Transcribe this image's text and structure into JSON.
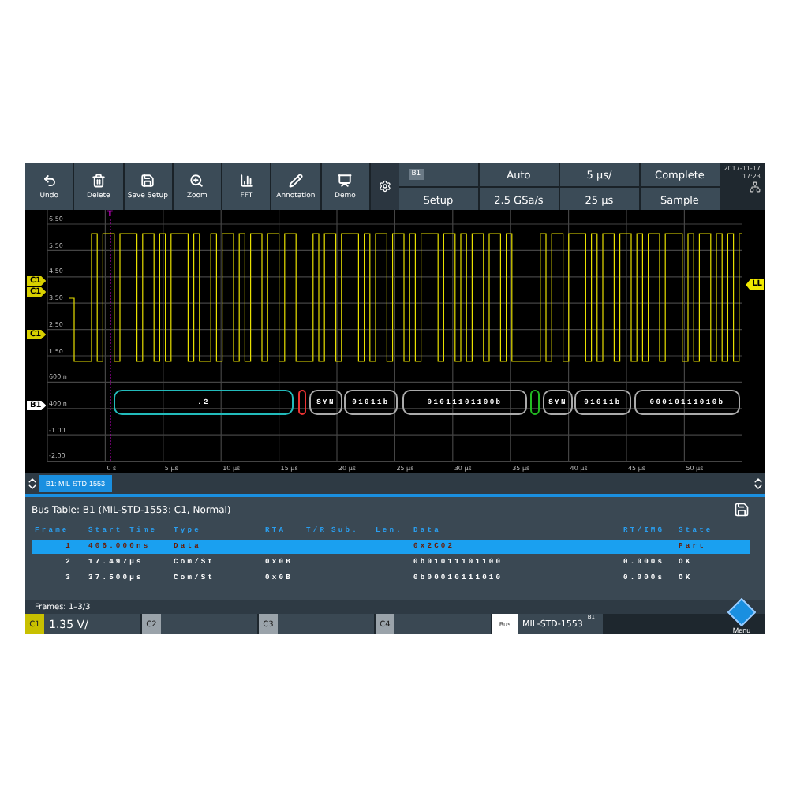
{
  "toolbar": {
    "buttons": [
      {
        "kind": "undo",
        "label": "Undo"
      },
      {
        "kind": "delete",
        "label": "Delete"
      },
      {
        "kind": "save",
        "label": "Save Setup"
      },
      {
        "kind": "zoom",
        "label": "Zoom"
      },
      {
        "kind": "fft",
        "label": "FFT"
      },
      {
        "kind": "annotation",
        "label": "Annotation"
      },
      {
        "kind": "demo",
        "label": "Demo"
      }
    ]
  },
  "acquisition": {
    "source": "B1",
    "setup": "Setup",
    "trigger_mode": "Auto",
    "sample_rate": "2.5 GSa/s",
    "time_scale": "5 µs/",
    "record_length": "25 µs",
    "status": "Complete",
    "mode": "Sample",
    "date": "2017-11-17",
    "time": "17:23"
  },
  "plot": {
    "y_labels": [
      "6.50",
      "5.50",
      "4.50",
      "3.50",
      "2.50",
      "1.50",
      "600 n",
      "400 n",
      "-1.00",
      "-2.00"
    ],
    "x_labels": [
      "0 s",
      "5 µs",
      "10 µs",
      "15 µs",
      "20 µs",
      "25 µs",
      "30 µs",
      "35 µs",
      "40 µs",
      "45 µs",
      "50 µs"
    ],
    "left_markers": [
      {
        "label": "C1"
      },
      {
        "label": "C1"
      },
      {
        "label": "C1"
      }
    ],
    "bus_marker": "B1",
    "right_marker": "LL",
    "trigger_label": "T",
    "bus_segments": [
      {
        "kind": "start",
        "text": ".2"
      },
      {
        "kind": "error"
      },
      {
        "kind": "data",
        "text": "SYN"
      },
      {
        "kind": "data",
        "text": "01011b"
      },
      {
        "kind": "data",
        "text": "01011101100b"
      },
      {
        "kind": "ok"
      },
      {
        "kind": "data",
        "text": "SYN"
      },
      {
        "kind": "data",
        "text": "01011b"
      },
      {
        "kind": "data",
        "text": "00010111010b"
      }
    ]
  },
  "tab": {
    "label": "B1: MIL-STD-1553",
    "selected": true
  },
  "table": {
    "title": "Bus Table: B1 (MIL-STD-1553: C1, Normal)",
    "columns": [
      "Frame",
      "Start Time",
      "Type",
      "RTA",
      "T/R",
      "Sub.",
      "Len.",
      "Data",
      "RT/IMG",
      "State"
    ],
    "rows": [
      {
        "selected": true,
        "cells": [
          "1",
          "406.000ns",
          "Data",
          "",
          "",
          "",
          "",
          "0x2C02",
          "",
          "Part"
        ]
      },
      {
        "selected": false,
        "cells": [
          "2",
          "17.497µs",
          "Com/St",
          "0x0B",
          "",
          "",
          "",
          "0b01011101100",
          "0.000s",
          "OK"
        ]
      },
      {
        "selected": false,
        "cells": [
          "3",
          "37.500µs",
          "Com/St",
          "0x0B",
          "",
          "",
          "",
          "0b00010111010",
          "0.000s",
          "OK"
        ]
      }
    ]
  },
  "frames": "Frames: 1–3/3",
  "channels": [
    {
      "label": "C1",
      "value": "1.35 V/",
      "active": true
    },
    {
      "label": "C2",
      "active": false
    },
    {
      "label": "C3",
      "active": false
    },
    {
      "label": "C4",
      "active": false
    }
  ],
  "bus": {
    "label": "Bus",
    "protocol": "MIL-STD-1553",
    "badge": "B1"
  },
  "menu": {
    "label": "Menu"
  }
}
